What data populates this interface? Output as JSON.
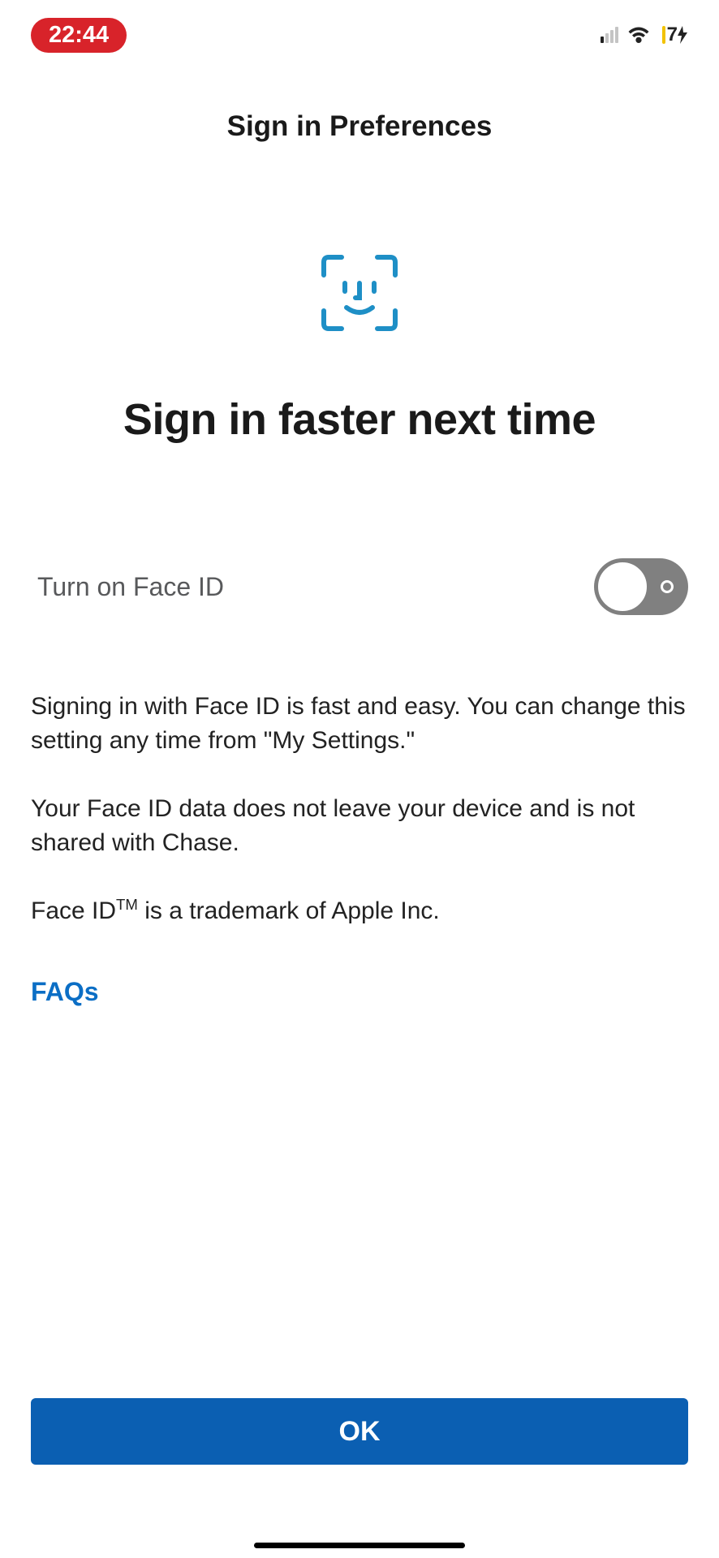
{
  "status": {
    "time": "22:44",
    "battery": "7"
  },
  "header": {
    "title": "Sign in Preferences"
  },
  "hero": {
    "title": "Sign in faster next time"
  },
  "toggle": {
    "label": "Turn on Face ID",
    "value": false
  },
  "description": {
    "p1": "Signing in with Face ID is fast and easy. You can change this setting any time from \"My Settings.\"",
    "p2": "Your Face ID data does not leave your device and is not shared with Chase.",
    "p3_prefix": "Face ID",
    "p3_tm": "TM",
    "p3_suffix": " is a trademark of Apple Inc."
  },
  "links": {
    "faqs": "FAQs"
  },
  "buttons": {
    "ok": "OK"
  },
  "colors": {
    "primary": "#0b5fb2",
    "link": "#0b6ec5",
    "timePill": "#d8232a",
    "iconBlue": "#1e8fc6"
  }
}
